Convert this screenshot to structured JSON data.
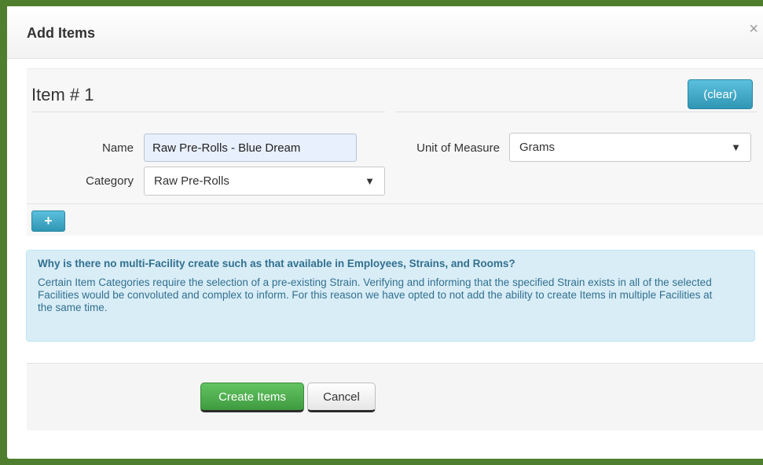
{
  "dialog": {
    "title": "Add Items",
    "close_glyph": "×"
  },
  "item": {
    "heading": "Item # 1",
    "clear_label": "(clear)",
    "name_label": "Name",
    "name_value": "Raw Pre-Rolls - Blue Dream",
    "category_label": "Category",
    "category_value": "Raw Pre-Rolls",
    "uom_label": "Unit of Measure",
    "uom_value": "Grams",
    "add_glyph": "+"
  },
  "info": {
    "title": "Why is there no multi-Facility create such as that available in Employees, Strains, and Rooms?",
    "body": "Certain Item Categories require the selection of a pre-existing Strain. Verifying and informing that the specified Strain exists in all of the selected Facilities would be convoluted and complex to inform. For this reason we have opted to not add the ability to create Items in multiple Facilities at the same time."
  },
  "footer": {
    "create_label": "Create Items",
    "cancel_label": "Cancel"
  },
  "icons": {
    "dropdown": "chevron-down-icon",
    "close": "close-icon",
    "add": "plus-icon"
  },
  "colors": {
    "backdrop": "#4f7f2e",
    "primary_info": "#2f96b4",
    "success": "#4cae4c",
    "info_bg": "#d9edf7",
    "info_text": "#31708f"
  }
}
